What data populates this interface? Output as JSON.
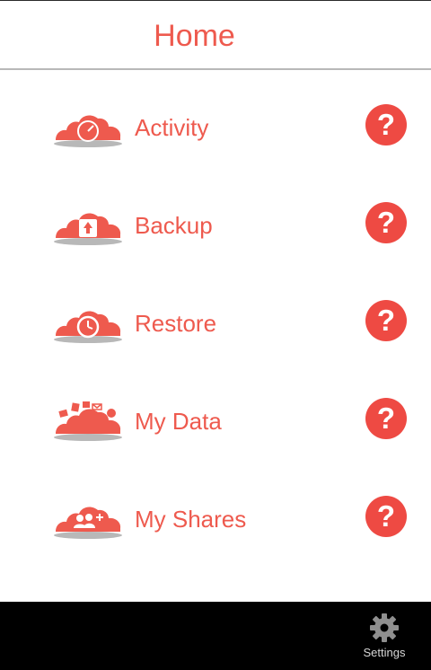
{
  "header": {
    "title": "Home"
  },
  "menu": {
    "items": [
      {
        "label": "Activity",
        "icon": "gauge-cloud-icon",
        "help_glyph": "?"
      },
      {
        "label": "Backup",
        "icon": "upload-cloud-icon",
        "help_glyph": "?"
      },
      {
        "label": "Restore",
        "icon": "clock-cloud-icon",
        "help_glyph": "?"
      },
      {
        "label": "My Data",
        "icon": "files-cloud-icon",
        "help_glyph": "?"
      },
      {
        "label": "My Shares",
        "icon": "users-cloud-icon",
        "help_glyph": "?"
      }
    ]
  },
  "bottom_bar": {
    "settings_label": "Settings",
    "settings_icon": "gear-icon"
  },
  "colors": {
    "accent": "#ee5a4e",
    "help": "#ee4a43",
    "bar": "#000000"
  }
}
